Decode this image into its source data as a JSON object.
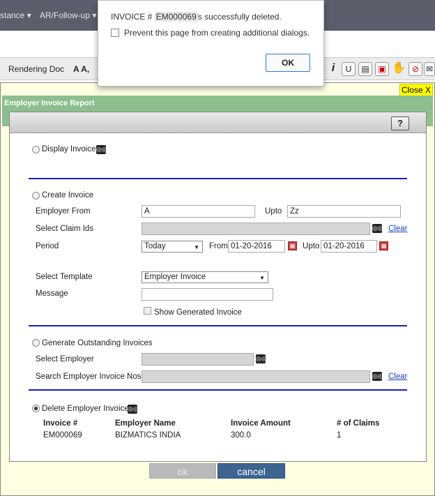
{
  "nav": {
    "item1": "stance ▾",
    "item2": "AR/Follow-up ▾"
  },
  "toolbar": {
    "label": "Rendering Doc",
    "value": "A A,"
  },
  "dialog": {
    "prefix": "INVOICE #",
    "invoice": "EM000069",
    "suffix": "s successfully deleted.",
    "prevent": "Prevent this page from creating additional dialogs.",
    "ok": "OK"
  },
  "modal": {
    "close": "Close X",
    "title": "Employer Invoice Report",
    "help": "?"
  },
  "display": {
    "label": "Display Invoice"
  },
  "create": {
    "label": "Create Invoice",
    "emp_from_label": "Employer From",
    "emp_from": "A",
    "upto_label": "Upto",
    "upto": "Zz",
    "claim_label": "Select Claim Ids",
    "clear": "Clear",
    "period_label": "Period",
    "period": "Today",
    "from_label": "From",
    "from_date": "01-20-2016",
    "upto2_label": "Upto",
    "upto_date": "01-20-2016",
    "template_label": "Select Template",
    "template": "Employer Invoice",
    "message_label": "Message",
    "show_generated": "Show Generated Invoice"
  },
  "outstanding": {
    "label": "Generate Outstanding Invoices",
    "select_emp": "Select Employer",
    "search_label": "Search Employer Invoice Nos",
    "clear": "Clear"
  },
  "delete": {
    "label": "Delete Employer Invoice",
    "headers": [
      "Invoice #",
      "Employer Name",
      "Invoice Amount",
      "# of Claims"
    ],
    "row": [
      "EM000069",
      "BIZMATICS INDIA",
      "300.0",
      "1"
    ]
  },
  "buttons": {
    "ok": "ok",
    "cancel": "cancel"
  }
}
